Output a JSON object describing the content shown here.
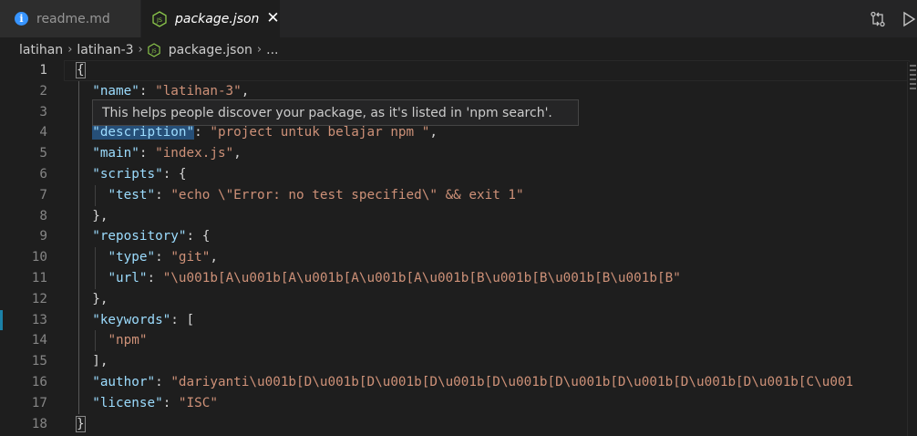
{
  "tabs": [
    {
      "label": "readme.md",
      "icon": "info-icon",
      "active": false
    },
    {
      "label": "package.json",
      "icon": "json-file-icon",
      "active": true,
      "close": "✕"
    }
  ],
  "breadcrumb": {
    "items": [
      "latihan",
      "latihan-3",
      "package.json",
      "..."
    ]
  },
  "tooltip": {
    "text": "This helps people discover your package, as it's listed in 'npm search'."
  },
  "editor": {
    "active_line": 1,
    "lines": [
      {
        "n": "1",
        "segments": [
          [
            "p",
            "{"
          ]
        ]
      },
      {
        "n": "2",
        "segments": [
          [
            "p",
            "  "
          ],
          [
            "k",
            "\"name\""
          ],
          [
            "p",
            ": "
          ],
          [
            "s",
            "\"latihan-3\""
          ],
          [
            "p",
            ","
          ]
        ]
      },
      {
        "n": "3",
        "segments": []
      },
      {
        "n": "4",
        "segments": [
          [
            "p",
            "  "
          ],
          [
            "k",
            "\"description\""
          ],
          [
            "p",
            ": "
          ],
          [
            "s",
            "\"project untuk belajar npm \""
          ],
          [
            "p",
            ","
          ]
        ]
      },
      {
        "n": "5",
        "segments": [
          [
            "p",
            "  "
          ],
          [
            "k",
            "\"main\""
          ],
          [
            "p",
            ": "
          ],
          [
            "s",
            "\"index.js\""
          ],
          [
            "p",
            ","
          ]
        ]
      },
      {
        "n": "6",
        "segments": [
          [
            "p",
            "  "
          ],
          [
            "k",
            "\"scripts\""
          ],
          [
            "p",
            ": {"
          ]
        ]
      },
      {
        "n": "7",
        "segments": [
          [
            "p",
            "    "
          ],
          [
            "k",
            "\"test\""
          ],
          [
            "p",
            ": "
          ],
          [
            "s",
            "\"echo \\\"Error: no test specified\\\" && exit 1\""
          ]
        ]
      },
      {
        "n": "8",
        "segments": [
          [
            "p",
            "  },"
          ]
        ]
      },
      {
        "n": "9",
        "segments": [
          [
            "p",
            "  "
          ],
          [
            "k",
            "\"repository\""
          ],
          [
            "p",
            ": {"
          ]
        ]
      },
      {
        "n": "10",
        "segments": [
          [
            "p",
            "    "
          ],
          [
            "k",
            "\"type\""
          ],
          [
            "p",
            ": "
          ],
          [
            "s",
            "\"git\""
          ],
          [
            "p",
            ","
          ]
        ]
      },
      {
        "n": "11",
        "segments": [
          [
            "p",
            "    "
          ],
          [
            "k",
            "\"url\""
          ],
          [
            "p",
            ": "
          ],
          [
            "s",
            "\"\\u001b[A\\u001b[A\\u001b[A\\u001b[A\\u001b[B\\u001b[B\\u001b[B\\u001b[B\""
          ]
        ]
      },
      {
        "n": "12",
        "segments": [
          [
            "p",
            "  },"
          ]
        ]
      },
      {
        "n": "13",
        "segments": [
          [
            "p",
            "  "
          ],
          [
            "k",
            "\"keywords\""
          ],
          [
            "p",
            ": ["
          ]
        ]
      },
      {
        "n": "14",
        "segments": [
          [
            "p",
            "    "
          ],
          [
            "s",
            "\"npm\""
          ]
        ]
      },
      {
        "n": "15",
        "segments": [
          [
            "p",
            "  ],"
          ]
        ]
      },
      {
        "n": "16",
        "segments": [
          [
            "p",
            "  "
          ],
          [
            "k",
            "\"author\""
          ],
          [
            "p",
            ": "
          ],
          [
            "s",
            "\"dariyanti\\u001b[D\\u001b[D\\u001b[D\\u001b[D\\u001b[D\\u001b[D\\u001b[D\\u001b[D\\u001b[C\\u001"
          ]
        ]
      },
      {
        "n": "17",
        "segments": [
          [
            "p",
            "  "
          ],
          [
            "k",
            "\"license\""
          ],
          [
            "p",
            ": "
          ],
          [
            "s",
            "\"ISC\""
          ]
        ]
      },
      {
        "n": "18",
        "segments": [
          [
            "p",
            "}"
          ]
        ]
      }
    ]
  }
}
